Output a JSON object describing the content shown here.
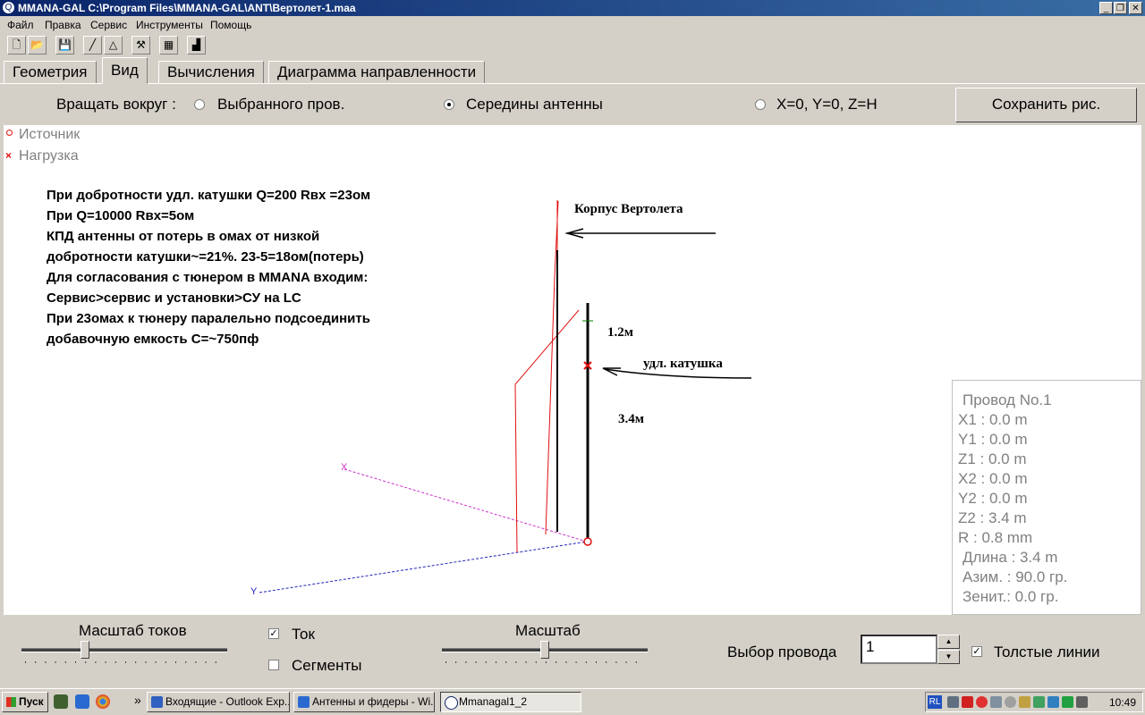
{
  "window": {
    "title": "MMANA-GAL C:\\Program Files\\MMANA-GAL\\ANT\\Вертолет-1.maa",
    "app_icon": "Q"
  },
  "menu": [
    "Файл",
    "Правка",
    "Сервис",
    "Инструменты",
    "Помощь"
  ],
  "tabs": [
    "Геометрия",
    "Вид",
    "Вычисления",
    "Диаграмма направленности"
  ],
  "rotate": {
    "label": "Вращать вокруг :",
    "options": [
      "Выбранного пров.",
      "Середины антенны",
      "X=0, Y=0, Z=H"
    ],
    "selected": "Середины антенны"
  },
  "save_button": "Сохранить рис.",
  "legend": {
    "source": "Источник",
    "load": "Нагрузка"
  },
  "notes": [
    "При добротности удл. катушки Q=200 Rвх =23ом",
    "При Q=10000  Rвх=5ом",
    "КПД антенны от потерь в омах от низкой",
    "добротности катушки~=21%.     23-5=18ом(потерь)",
    "Для согласования с тюнером в MMANA входим:",
    "Сервис>сервис и установки>СУ на LC",
    "При 23омах к тюнеру паралельно подсоединить",
    "добавочную емкость С=~750пф"
  ],
  "annotations": {
    "hull": "Корпус Вертолета",
    "coil": "удл. катушка",
    "len1": "1.2м",
    "len2": "3.4м"
  },
  "axes": {
    "x": "X",
    "y": "Y"
  },
  "wire_info": {
    "title": "Провод No.1",
    "rows": [
      "X1   :  0.0 m",
      "Y1   :  0.0 m",
      "Z1   :  0.0 m",
      "X2   :  0.0 m",
      "Y2   :  0.0 m",
      "Z2   :  3.4 m",
      "R    :  0.8 mm",
      "Длина  :  3.4 m",
      "Азим.   :  90.0 гр.",
      "Зенит.:  0.0 гр."
    ]
  },
  "controls": {
    "current_scale_label": "Масштаб токов",
    "current_label": "Ток",
    "segments_label": "Сегменты",
    "scale_label": "Масштаб",
    "wire_select_label": "Выбор провода",
    "wire_select_value": "1",
    "thick_lines_label": "Толстые линии",
    "current_checked": true,
    "segments_checked": false,
    "thick_lines_checked": true
  },
  "taskbar": {
    "start": "Пуск",
    "more": "»",
    "tasks": [
      "Входящие - Outlook Exp...",
      "Антенны и фидеры - Wi...",
      "Mmanagal1_2"
    ],
    "lang": "RL",
    "clock": "10:49"
  },
  "colors": {
    "titlebar": "#0a246a",
    "wire_red": "#e01010",
    "source_circle": "#e01010",
    "x_axis": "#cc33cc",
    "y_axis": "#2222bb",
    "green_mark": "#008000"
  }
}
